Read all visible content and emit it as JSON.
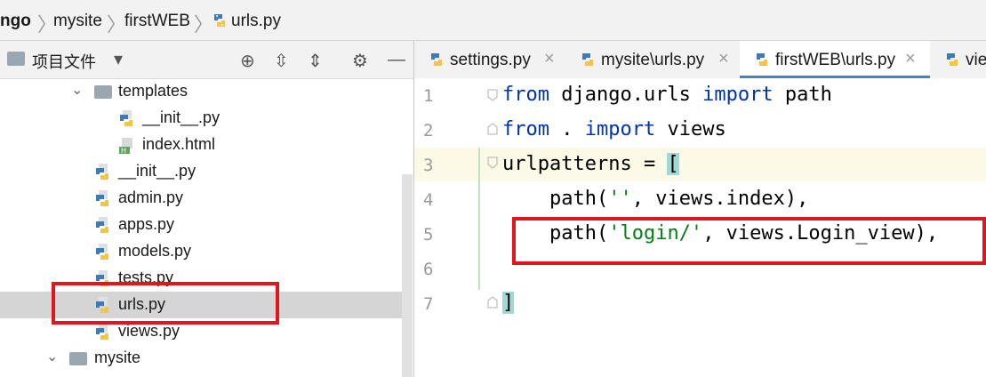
{
  "breadcrumb": {
    "items": [
      "ngo",
      "mysite",
      "firstWEB",
      "urls.py"
    ]
  },
  "project_panel": {
    "title": "项目文件",
    "tree": [
      {
        "label": "templates",
        "type": "folder",
        "indent": 2,
        "expanded": true
      },
      {
        "label": "__init__.py",
        "type": "python",
        "indent": 3
      },
      {
        "label": "index.html",
        "type": "html",
        "indent": 3
      },
      {
        "label": "__init__.py",
        "type": "python",
        "indent": 2
      },
      {
        "label": "admin.py",
        "type": "python",
        "indent": 2
      },
      {
        "label": "apps.py",
        "type": "python",
        "indent": 2
      },
      {
        "label": "models.py",
        "type": "python",
        "indent": 2
      },
      {
        "label": "tests.py",
        "type": "python",
        "indent": 2
      },
      {
        "label": "urls.py",
        "type": "python",
        "indent": 2,
        "selected": true
      },
      {
        "label": "views.py",
        "type": "python",
        "indent": 2
      },
      {
        "label": "mysite",
        "type": "folder",
        "indent": 1,
        "expanded": true
      }
    ]
  },
  "tabs": [
    {
      "label": "settings.py",
      "active": false
    },
    {
      "label": "mysite\\urls.py",
      "active": false
    },
    {
      "label": "firstWEB\\urls.py",
      "active": true
    },
    {
      "label": "vie",
      "active": false
    }
  ],
  "editor": {
    "line_numbers": [
      "1",
      "2",
      "3",
      "4",
      "5",
      "6",
      "7"
    ],
    "lines": [
      {
        "t": [
          {
            "k": "kw",
            "v": "from"
          },
          {
            "k": "",
            "v": " django.urls "
          },
          {
            "k": "kw",
            "v": "import"
          },
          {
            "k": "",
            "v": " path"
          }
        ]
      },
      {
        "t": [
          {
            "k": "kw",
            "v": "from"
          },
          {
            "k": "",
            "v": " . "
          },
          {
            "k": "kw",
            "v": "import"
          },
          {
            "k": "",
            "v": " views"
          }
        ]
      },
      {
        "t": [
          {
            "k": "",
            "v": "urlpatterns = "
          },
          {
            "k": "brk",
            "v": "["
          }
        ]
      },
      {
        "t": [
          {
            "k": "",
            "v": "    path("
          },
          {
            "k": "str",
            "v": "''"
          },
          {
            "k": "",
            "v": ", views.index),"
          }
        ]
      },
      {
        "t": [
          {
            "k": "",
            "v": "    path("
          },
          {
            "k": "str",
            "v": "'login/'"
          },
          {
            "k": "",
            "v": ", views.Login_view),"
          }
        ]
      },
      {
        "t": []
      },
      {
        "t": [
          {
            "k": "brk",
            "v": "]"
          }
        ]
      }
    ]
  },
  "colors": {
    "keyword": "#0033b3",
    "string": "#067d17",
    "annotation": "#e0161c",
    "active_tab_underline": "#4083c9"
  }
}
